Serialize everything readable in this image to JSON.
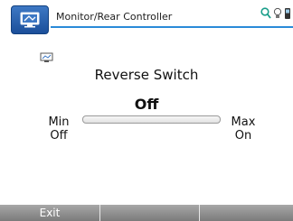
{
  "window": {
    "title": "Monitor/Rear Controller"
  },
  "icons": {
    "app": "monitor-controller-icon",
    "status": [
      "search-icon",
      "lightbulb-icon",
      "phone-icon"
    ],
    "device": "monitor-small-icon"
  },
  "control": {
    "title": "Reverse Switch",
    "value": "Off",
    "min_label_line1": "Min",
    "min_label_line2": "Off",
    "max_label_line1": "Max",
    "max_label_line2": "On",
    "level": 0
  },
  "softkeys": [
    {
      "label": "Exit"
    },
    {
      "label": ""
    },
    {
      "label": ""
    }
  ],
  "colors": {
    "accent": "#2a8ad8",
    "softkey_bar": "#8e8e8e"
  }
}
